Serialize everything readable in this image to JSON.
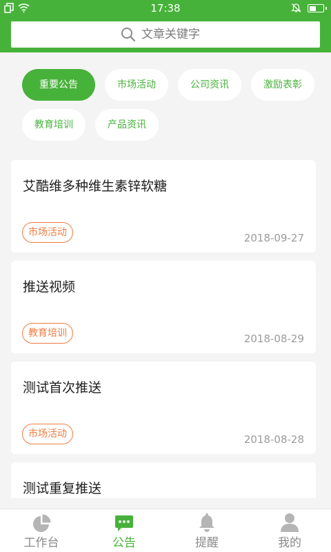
{
  "status_bar": {
    "time": "17:38",
    "battery_level": 0.5,
    "icons": [
      "dual-sim-icon",
      "wifi-icon",
      "notification-off-icon",
      "battery-icon"
    ]
  },
  "search": {
    "placeholder": "文章关键字",
    "icon": "search-icon"
  },
  "categories": [
    {
      "label": "重要公告",
      "selected": true
    },
    {
      "label": "市场活动",
      "selected": false
    },
    {
      "label": "公司资讯",
      "selected": false
    },
    {
      "label": "激励表彰",
      "selected": false
    },
    {
      "label": "教育培训",
      "selected": false
    },
    {
      "label": "产品资讯",
      "selected": false
    }
  ],
  "articles": [
    {
      "title": "艾酷维多种维生素锌软糖",
      "tag": "市场活动",
      "date": "2018-09-27"
    },
    {
      "title": "推送视频",
      "tag": "教育培训",
      "date": "2018-08-29"
    },
    {
      "title": "测试首次推送",
      "tag": "市场活动",
      "date": "2018-08-28"
    },
    {
      "title": "测试重复推送"
    }
  ],
  "bottom_nav": [
    {
      "label": "工作台",
      "icon": "pie-chart-icon",
      "active": false
    },
    {
      "label": "公告",
      "icon": "chat-bubble-icon",
      "active": true
    },
    {
      "label": "提醒",
      "icon": "bell-icon",
      "active": false
    },
    {
      "label": "我的",
      "icon": "person-icon",
      "active": false
    }
  ],
  "colors": {
    "primary_green": "#47b23a",
    "tag_orange": "#ee7b40",
    "background": "#f4f4f4",
    "date_gray": "#9b9b9b",
    "inactive_icon_gray": "#b5b5b5"
  }
}
